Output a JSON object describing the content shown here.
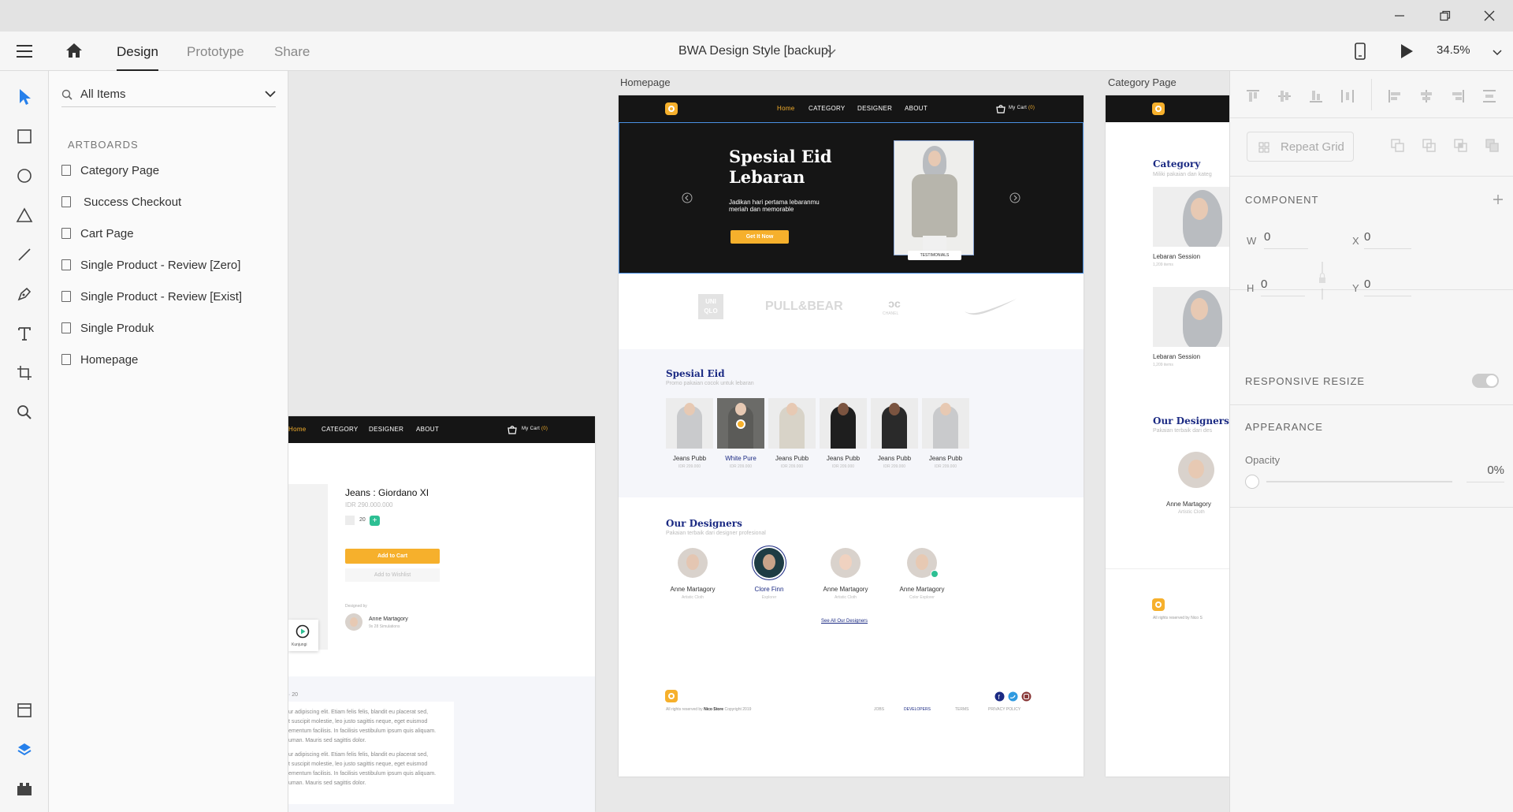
{
  "window": {
    "title": "BWA Design Style [backup]",
    "zoom": "34.5%"
  },
  "tabs": {
    "design": "Design",
    "prototype": "Prototype",
    "share": "Share"
  },
  "layers": {
    "search_placeholder": "All Items",
    "section": "ARTBOARDS",
    "items": [
      "Category Page",
      "Success Checkout",
      "Cart Page",
      "Single Product - Review [Zero]",
      "Single Product - Review [Exist]",
      "Single Produk",
      "Homepage"
    ]
  },
  "artboards": {
    "homepage": "Homepage",
    "category": "Category Page"
  },
  "home": {
    "nav": {
      "home": "Home",
      "category": "CATEGORY",
      "designer": "DESIGNER",
      "about": "ABOUT",
      "cart": "My Cart",
      "cart_count": "(0)"
    },
    "hero": {
      "title_1": "Spesial Eid",
      "title_2": "Lebaran",
      "desc_1": "Jadikan hari pertama lebaranmu",
      "desc_2": "meriah dan memorable",
      "cta": "Get It Now",
      "badge": "TESTIMONIALS"
    },
    "brands": {
      "b1": "UNI QLO",
      "b2": "PULL&BEAR",
      "b3": "CHANEL"
    },
    "spesial": {
      "title": "Spesial Eid",
      "subtitle": "Promo pakaian cocok untuk lebaran",
      "products": [
        {
          "name": "Jeans Pubb",
          "price": "IDR 209.000"
        },
        {
          "name": "White Pure",
          "price": "IDR 209.000"
        },
        {
          "name": "Jeans Pubb",
          "price": "IDR 209.000"
        },
        {
          "name": "Jeans Pubb",
          "price": "IDR 209.000"
        },
        {
          "name": "Jeans Pubb",
          "price": "IDR 209.000"
        },
        {
          "name": "Jeans Pubb",
          "price": "IDR 209.000"
        }
      ]
    },
    "designers": {
      "title": "Our Designers",
      "subtitle": "Pakaian terbaik dari designer profesional",
      "list": [
        {
          "name": "Anne Martagory",
          "role": "Artistic Cloth"
        },
        {
          "name": "Clore Finn",
          "role": "Explorer"
        },
        {
          "name": "Anne Martagory",
          "role": "Artistic Cloth"
        },
        {
          "name": "Anne Martagory",
          "role": "Color Explorer"
        }
      ],
      "see_all": "See All Our Designers"
    },
    "footer": {
      "copy_1": "All rights reserved by ",
      "brand": "Nico Store",
      "copy_2": " Copyright 2019",
      "links": [
        "JOBS",
        "DEVELOPERS",
        "TERMS",
        "PRIVACY POLICY"
      ]
    }
  },
  "product": {
    "nav": {
      "home": "Home",
      "category": "CATEGORY",
      "designer": "DESIGNER",
      "about": "ABOUT",
      "cart": "My Cart",
      "cart_count": "(0)"
    },
    "name": "Jeans : Giordano XI",
    "price": "IDR 290.000.000",
    "qty": "20",
    "add_cart": "Add to Cart",
    "wishlist": "Add to Wishlist",
    "designed_by": "Designed by",
    "designer": "Anne Martagory",
    "designer_meta": "9x 28 Simulations",
    "review_count": "20",
    "play_label": "Kunjungi",
    "review_1a": "ur adipiscing elit. Etiam felis felis, blandit eu placerat sed,",
    "review_1b": "t suscipit molestie, leo justo sagittis neque, eget euismod",
    "review_1c": "ementum facilisis. In facilisis vestibulum ipsum quis aliquam.",
    "review_1d": "uman. Mauris sed sagittis dolor.",
    "review_2a": "ur adipiscing elit. Etiam felis felis, blandit eu placerat sed,",
    "review_2b": "t suscipit molestie, leo justo sagittis neque, eget euismod",
    "review_2c": "ementum facilisis. In facilisis vestibulum ipsum quis aliquam.",
    "review_2d": "uman. Mauris sed sagittis dolor."
  },
  "category": {
    "title": "Category",
    "subtitle": "Miliki pakaian dan kateg",
    "items": [
      {
        "name": "Lebaran Session",
        "count": "1,209 items"
      },
      {
        "name": "Lebaran Session",
        "count": "1,209 items"
      }
    ],
    "designers_title": "Our Designers",
    "designers_sub": "Pakaian terbaik dari des",
    "designer": "Anne Martagory",
    "role": "Artistic Cloth",
    "footer": "All rights reserved by Nico S"
  },
  "props": {
    "repeat_grid": "Repeat Grid",
    "component": "COMPONENT",
    "w_label": "W",
    "w": "0",
    "h_label": "H",
    "h": "0",
    "x_label": "X",
    "x": "0",
    "y_label": "Y",
    "y": "0",
    "responsive": "RESPONSIVE RESIZE",
    "appearance": "APPEARANCE",
    "opacity_label": "Opacity",
    "opacity": "0%"
  },
  "colors": {
    "accent": "#f6b02c",
    "navy": "#1b2a83",
    "dark": "#151515",
    "teal": "#2dbf93",
    "selection": "#4a90e2"
  }
}
